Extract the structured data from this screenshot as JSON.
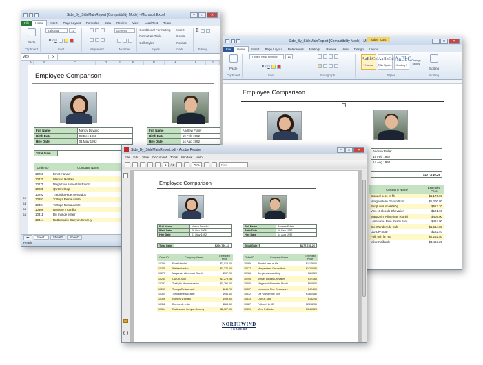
{
  "excel": {
    "title": "Side_By_SideMainReport [Compatibility Mode] - Microsoft Excel",
    "tabs": [
      "File",
      "Home",
      "Insert",
      "Page Layout",
      "Formulas",
      "Data",
      "Review",
      "View",
      "Load Test",
      "Team"
    ],
    "font_name": "Tahoma",
    "font_size": "10",
    "number_format": "General",
    "groups": [
      "Clipboard",
      "Font",
      "Alignment",
      "Number",
      "Styles",
      "Cells",
      "Editing"
    ],
    "styles_items": [
      "Conditional Formatting",
      "Format as Table",
      "Cell Styles"
    ],
    "cells_items": [
      "Insert",
      "Delete",
      "Format"
    ],
    "paste_label": "Paste",
    "name_box": "V29",
    "formula_label": "fx",
    "columns": [
      "A",
      "B",
      "C",
      "D",
      "E",
      "F",
      "G",
      "H",
      "I",
      "J"
    ],
    "heading": "Employee Comparison",
    "left": {
      "full_name_label": "Full Name",
      "full_name": "Nancy Davolio",
      "birth_label": "Birth Date",
      "birth": "08 Dec 1968",
      "hire_label": "Hire Date",
      "hire": "01 May 1992",
      "total_label": "Total Gain",
      "total": "$200"
    },
    "right": {
      "full_name_label": "Full Name",
      "full_name": "Andrew Fuller",
      "birth_label": "Birth Date",
      "birth": "19 Feb 1952",
      "hire_label": "Hire Date",
      "hire": "14 Aug 1992"
    },
    "order_headers": [
      "Order ID",
      "Company Name",
      "Exte Pr"
    ],
    "row_numbers": [
      "12",
      "13",
      "14",
      "15",
      "16",
      "17",
      "18",
      "19",
      "20",
      "21",
      "22",
      "23"
    ],
    "orders": [
      {
        "id": "10258",
        "company": "Ernst Handel"
      },
      {
        "id": "10270",
        "company": "Wartian Herkku"
      },
      {
        "id": "10275",
        "company": "Magazzini Alimentari Riuniti"
      },
      {
        "id": "10285",
        "company": "QUICK-Stop"
      },
      {
        "id": "10292",
        "company": "Tradição Hipermercados"
      },
      {
        "id": "10293",
        "company": "Tortuga Restaurante"
      },
      {
        "id": "10304",
        "company": "Tortuga Restaurante"
      },
      {
        "id": "10306",
        "company": "Romero y tomillo"
      },
      {
        "id": "10311",
        "company": "Du monde entier"
      },
      {
        "id": "10314",
        "company": "Rattlesnake Canyon Grocery"
      }
    ],
    "sheets": [
      "Sheet1",
      "Sheet2",
      "Sheet3"
    ],
    "status": "Ready"
  },
  "word": {
    "title": "Side_By_SideMainReport [Compatibility Mode] - Microsoft Word",
    "contextual_tab": "Table Tools",
    "tabs": [
      "File",
      "Home",
      "Insert",
      "Page Layout",
      "References",
      "Mailings",
      "Review",
      "View",
      "Design",
      "Layout"
    ],
    "font_name": "Times New Roman",
    "font_size": "11",
    "groups": [
      "Clipboard",
      "Font",
      "Paragraph",
      "Styles",
      "Editing"
    ],
    "styles": [
      {
        "sample": "AaBbCcI",
        "name": "¶ Normal"
      },
      {
        "sample": "AaBbCcI",
        "name": "¶ No Spaci..."
      },
      {
        "sample": "AaBbC",
        "name": "Heading 1"
      }
    ],
    "change_styles": "Change Styles",
    "editing": "Editing",
    "paste_label": "Paste",
    "heading": "Employee Comparison",
    "right": {
      "full_name": "Andrew Fuller",
      "birth": "19 Feb 1952",
      "hire": "14 Aug 1992",
      "total": "$177,749.26"
    },
    "order_headers": [
      "Company Name",
      "Extended Price"
    ],
    "orders": [
      {
        "company": "Blondel père et fils",
        "price": "$1,176.00"
      },
      {
        "company": "Morgenstern Gesundkost",
        "price": "$1,200.80"
      },
      {
        "company": "Berglunds snabbköp",
        "price": "$613.20"
      },
      {
        "company": "Vins et alcools Chevalier",
        "price": "$121.60"
      },
      {
        "company": "Magazzini Alimentari Riuniti",
        "price": "$408.00"
      },
      {
        "company": "Lonesome Pine Restaurant",
        "price": "$424.00"
      },
      {
        "company": "Die Wandernde Kuh",
        "price": "$1,614.88"
      },
      {
        "company": "QUICK-Stop",
        "price": "$182.40"
      },
      {
        "company": "Folk och fä HB",
        "price": "$2,262.50"
      },
      {
        "company": "Mère Paillarde",
        "price": "$3,463.20"
      }
    ]
  },
  "pdf": {
    "title": "Side_By_SideMainReport.pdf - Adobe Reader",
    "menu": [
      "File",
      "Edit",
      "View",
      "Document",
      "Tools",
      "Window",
      "Help"
    ],
    "page_num": "1",
    "page_total": "/ 1",
    "zoom": "75%",
    "find": "Find",
    "heading": "Employee Comparison",
    "left": {
      "full_name_label": "Full Name",
      "full_name": "Nancy Davolio",
      "birth_label": "Birth Date",
      "birth": "08 Dec 1968",
      "hire_label": "Hire Date",
      "hire": "01 May 1992",
      "total_label": "Total Gain",
      "total": "$200,791.13"
    },
    "right": {
      "full_name_label": "Full Name",
      "full_name": "Andrew Fuller",
      "birth_label": "Birth Date",
      "birth": "19 Feb 1952",
      "hire_label": "Hire Date",
      "hire": "14 Aug 1992",
      "total_label": "Total Gain",
      "total": "$177,749.26"
    },
    "order_headers": [
      "Order ID",
      "Company Name",
      "Extended Price"
    ],
    "left_orders": [
      {
        "id": "10258",
        "company": "Ernst Handel",
        "price": "$2,018.60"
      },
      {
        "id": "10270",
        "company": "Wartian Herkku",
        "price": "$1,376.00"
      },
      {
        "id": "10275",
        "company": "Magazzini Alimentari Riuniti",
        "price": "$307.20"
      },
      {
        "id": "10285",
        "company": "QUICK-Stop",
        "price": "$1,279.28"
      },
      {
        "id": "10292",
        "company": "Tradição Hipermercados",
        "price": "$1,296.00"
      },
      {
        "id": "10293",
        "company": "Tortuga Restaurante",
        "price": "$848.70"
      },
      {
        "id": "10304",
        "company": "Tortuga Restaurante",
        "price": "$954.40"
      },
      {
        "id": "10306",
        "company": "Romero y tomillo",
        "price": "$498.50"
      },
      {
        "id": "10311",
        "company": "Du monde entier",
        "price": "$268.80"
      },
      {
        "id": "10314",
        "company": "Rattlesnake Canyon Grocery",
        "price": "$2,327.00"
      }
    ],
    "right_orders": [
      {
        "id": "10265",
        "company": "Blondel père et fils",
        "price": "$1,176.00"
      },
      {
        "id": "10277",
        "company": "Morgenstern Gesundkost",
        "price": "$1,200.80"
      },
      {
        "id": "10286",
        "company": "Berglunds snabbköp",
        "price": "$613.20"
      },
      {
        "id": "10295",
        "company": "Vins et alcools Chevalier",
        "price": "$121.60"
      },
      {
        "id": "10300",
        "company": "Magazzini Alimentari Riuniti",
        "price": "$608.00"
      },
      {
        "id": "10307",
        "company": "Lonesome Pine Restaurant",
        "price": "$424.00"
      },
      {
        "id": "10312",
        "company": "Die Wandernde Kuh",
        "price": "$1,614.80"
      },
      {
        "id": "10313",
        "company": "QUICK-Stop",
        "price": "$182.40"
      },
      {
        "id": "10327",
        "company": "Folk och fä HB",
        "price": "$2,262.50"
      },
      {
        "id": "10339",
        "company": "Mère Paillarde",
        "price": "$3,463.20"
      }
    ],
    "logo_main": "NORTHWIND",
    "logo_sub": "TRADERS"
  }
}
